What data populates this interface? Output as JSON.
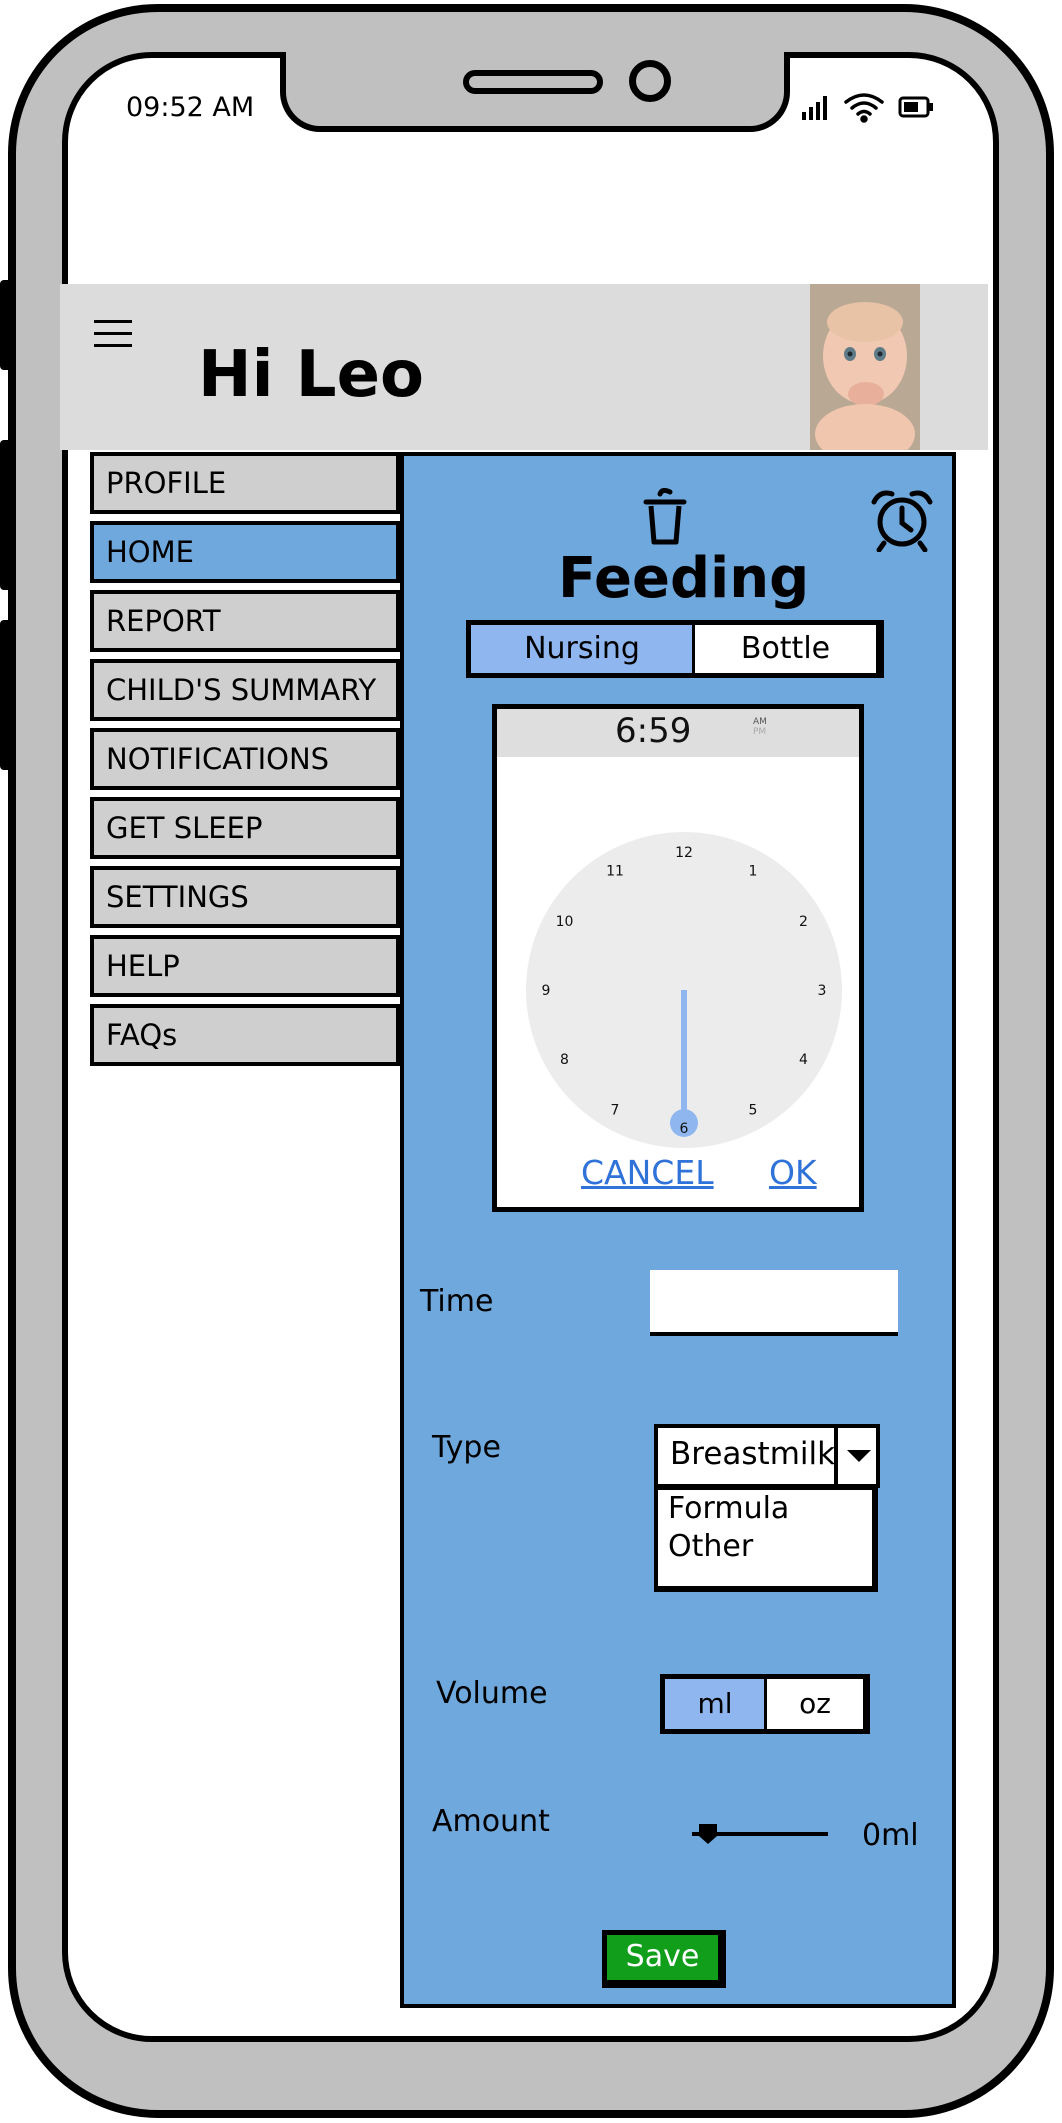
{
  "status_bar": {
    "time": "09:52 AM"
  },
  "header": {
    "greeting": "Hi Leo"
  },
  "side_menu": {
    "items": [
      {
        "label": "PROFILE"
      },
      {
        "label": "HOME"
      },
      {
        "label": "REPORT"
      },
      {
        "label": "CHILD'S SUMMARY"
      },
      {
        "label": "NOTIFICATIONS"
      },
      {
        "label": "GET SLEEP"
      },
      {
        "label": "SETTINGS"
      },
      {
        "label": "HELP"
      },
      {
        "label": "FAQs"
      }
    ],
    "active": "HOME"
  },
  "feeding": {
    "title": "Feeding",
    "mode_tabs": {
      "nursing": "Nursing",
      "bottle": "Bottle",
      "selected": "Nursing"
    },
    "time_picker": {
      "display": "6:59",
      "am": "AM",
      "pm": "PM",
      "dial_numbers": [
        "12",
        "1",
        "2",
        "3",
        "4",
        "5",
        "6",
        "7",
        "8",
        "9",
        "10",
        "11"
      ],
      "selected_hour": "6",
      "cancel": "CANCEL",
      "ok": "OK"
    },
    "time": {
      "label": "Time",
      "value": ""
    },
    "type": {
      "label": "Type",
      "selected": "Breastmilk",
      "options": [
        "Formula",
        "Other"
      ]
    },
    "volume": {
      "label": "Volume",
      "ml": "ml",
      "oz": "oz",
      "selected": "ml"
    },
    "amount": {
      "label": "Amount",
      "value_text": "0ml",
      "value": 0
    },
    "save_label": "Save"
  },
  "colors": {
    "panel": "#6fa8dc",
    "selected_segment": "#8fb6ef",
    "save_button": "#109e1b",
    "link": "#2f72d8"
  },
  "icons": [
    "menu-icon",
    "trash-icon",
    "alarm-clock-icon",
    "signal-icon",
    "wifi-icon",
    "battery-icon"
  ]
}
